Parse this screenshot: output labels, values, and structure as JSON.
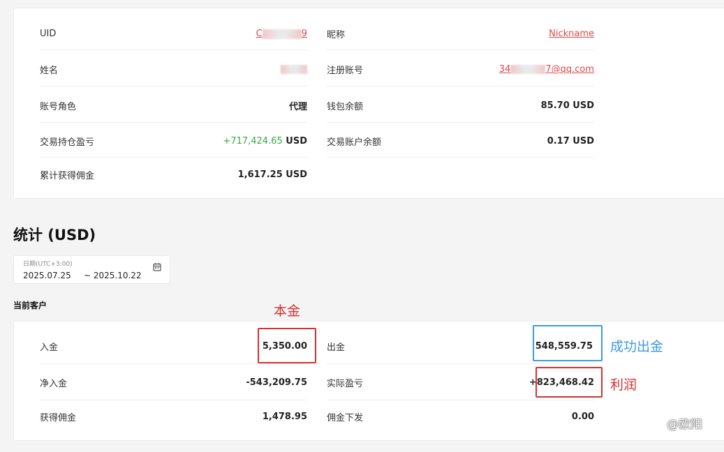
{
  "account": {
    "uid_label": "UID",
    "uid_prefix": "C",
    "uid_suffix": "9",
    "nickname_label": "昵称",
    "nickname_value": "Nickname",
    "name_label": "姓名",
    "register_label": "注册账号",
    "register_prefix": "34",
    "register_suffix": "7@qq.com",
    "role_label": "账号角色",
    "role_value": "代理",
    "wallet_label": "钱包余额",
    "wallet_value": "85.70 USD",
    "pnl_label": "交易持仓盈亏",
    "pnl_value": "+717,424.65",
    "pnl_unit": "USD",
    "trade_balance_label": "交易账户余额",
    "trade_balance_value": "0.17 USD",
    "commission_total_label": "累计获得佣金",
    "commission_total_value": "1,617.25 USD"
  },
  "stats": {
    "title": "统计 (USD)",
    "date_label": "日期(UTC+3:00)",
    "date_start": "2025.07.25",
    "date_end": "~ 2025.10.22",
    "sub_title": "当前客户",
    "deposit_label": "入金",
    "deposit_value": "5,350.00",
    "withdraw_label": "出金",
    "withdraw_value": "548,559.75",
    "net_deposit_label": "净入金",
    "net_deposit_value": "-543,209.75",
    "actual_pnl_label": "实际盈亏",
    "actual_pnl_value": "+823,468.42",
    "commission_label": "获得佣金",
    "commission_value": "1,478.95",
    "payout_label": "佣金下发",
    "payout_value": "0.00"
  },
  "annotations": {
    "principal": "本金",
    "withdraw_success": "成功出金",
    "profit": "利润"
  },
  "watermark": "@欧阳",
  "colors": {
    "positive": "#3aa745",
    "link": "#e0474c",
    "annotation_red": "#d7302f",
    "annotation_blue": "#3c9be0"
  }
}
